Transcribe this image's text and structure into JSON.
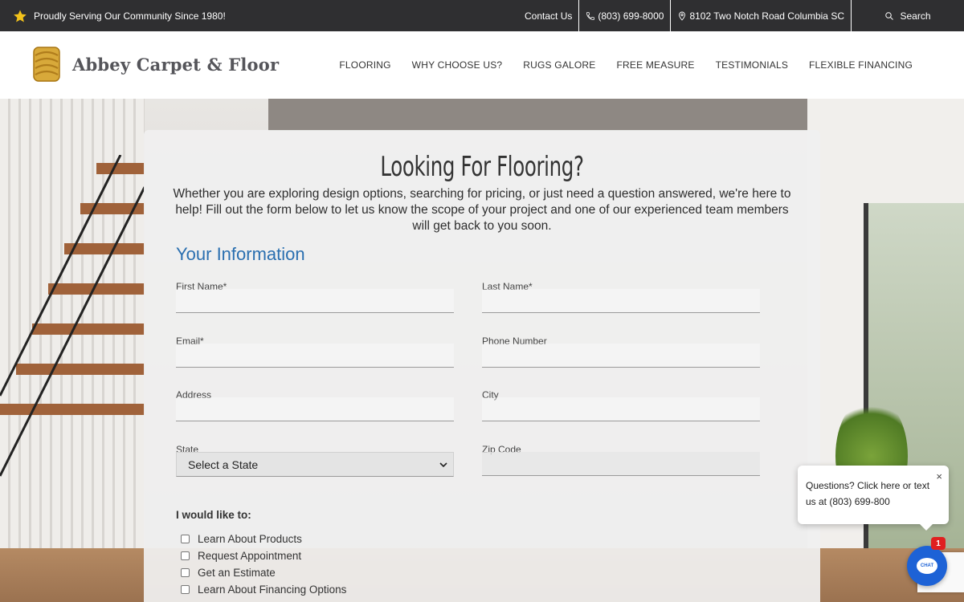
{
  "topbar": {
    "promo": "Proudly Serving Our Community Since 1980!",
    "contact": "Contact Us",
    "phone": "(803) 699-8000",
    "address": "8102 Two Notch Road Columbia SC",
    "search": "Search"
  },
  "header": {
    "brand": "Abbey Carpet & Floor",
    "nav": [
      "FLOORING",
      "WHY CHOOSE US?",
      "RUGS GALORE",
      "FREE MEASURE",
      "TESTIMONIALS",
      "FLEXIBLE FINANCING"
    ]
  },
  "form": {
    "title": "Looking For Flooring?",
    "intro": "Whether you are exploring design options, searching for pricing, or just need a question answered, we're here to help! Fill out the form below to let us know the scope of your project and one of our experienced team members will get back to you soon.",
    "section": "Your Information",
    "fields": {
      "first_name": "First Name*",
      "last_name": "Last Name*",
      "email": "Email*",
      "phone": "Phone Number",
      "address": "Address",
      "city": "City",
      "state": "State",
      "zip": "Zip Code"
    },
    "state_selected": "Select a State",
    "interest_heading": "I would like to:",
    "interests": [
      "Learn About Products",
      "Request Appointment",
      "Get an Estimate",
      "Learn About Financing Options"
    ]
  },
  "chat": {
    "message": "Questions? Click here or text us at (803) 699-800",
    "close": "×",
    "badge": "1",
    "button": "CHAT"
  },
  "colors": {
    "topbar": "#2f2f31",
    "accent_blue": "#2a6fb0",
    "logo_gold": "#d8a93a",
    "star_yellow": "#f2c21b",
    "chat_blue": "#1d62d6"
  }
}
